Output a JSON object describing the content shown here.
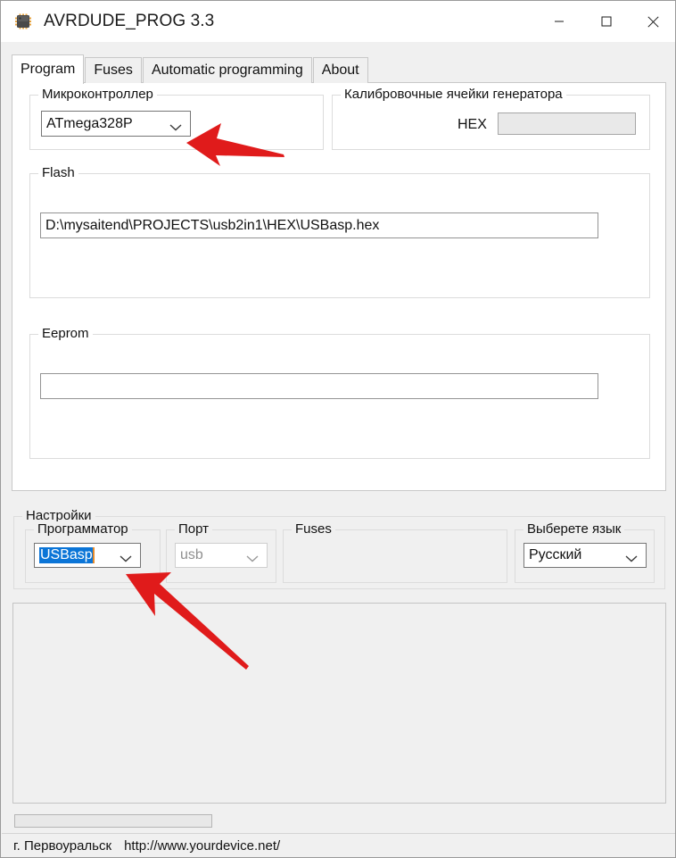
{
  "window": {
    "title": "AVRDUDE_PROG 3.3",
    "icon": "microcontroller-chip-icon",
    "controls": {
      "minimize": "minimize-icon",
      "maximize": "maximize-icon",
      "close": "close-icon"
    }
  },
  "tabs": [
    {
      "label": "Program",
      "active": true
    },
    {
      "label": "Fuses",
      "active": false
    },
    {
      "label": "Automatic programming",
      "active": false
    },
    {
      "label": "About",
      "active": false
    }
  ],
  "program_tab": {
    "mcu_group": {
      "label": "Микроконтроллер",
      "combo_value": "ATmega328P",
      "chevron": "chevron-down-icon"
    },
    "calibration_group": {
      "label": "Калибровочные ячейки генератора",
      "hex_label": "HEX",
      "hex_value": "",
      "hex_disabled": true
    },
    "flash_group": {
      "label": "Flash",
      "path_value": "D:\\mysaitend\\PROJECTS\\usb2in1\\HEX\\USBasp.hex"
    },
    "eeprom_group": {
      "label": "Eeprom",
      "path_value": ""
    }
  },
  "settings": {
    "label": "Настройки",
    "programmer": {
      "label": "Программатор",
      "value": "USBasp",
      "selected": true,
      "chevron": "chevron-down-icon"
    },
    "port": {
      "label": "Порт",
      "value": "usb",
      "disabled": true,
      "chevron": "chevron-down-icon"
    },
    "fuses": {
      "label": "Fuses"
    },
    "language": {
      "label": "Выберете язык",
      "value": "Русский",
      "chevron": "chevron-down-icon"
    }
  },
  "log": {
    "content": ""
  },
  "progress": {
    "value": 0
  },
  "status_bar": {
    "city": "г. Первоуральск",
    "url": "http://www.yourdevice.net/"
  },
  "annotations": {
    "arrow_mcu": "red-arrow-pointing-to-mcu-combo",
    "arrow_programmer": "red-arrow-pointing-to-programmer-combo",
    "color": "#E01B1B"
  }
}
